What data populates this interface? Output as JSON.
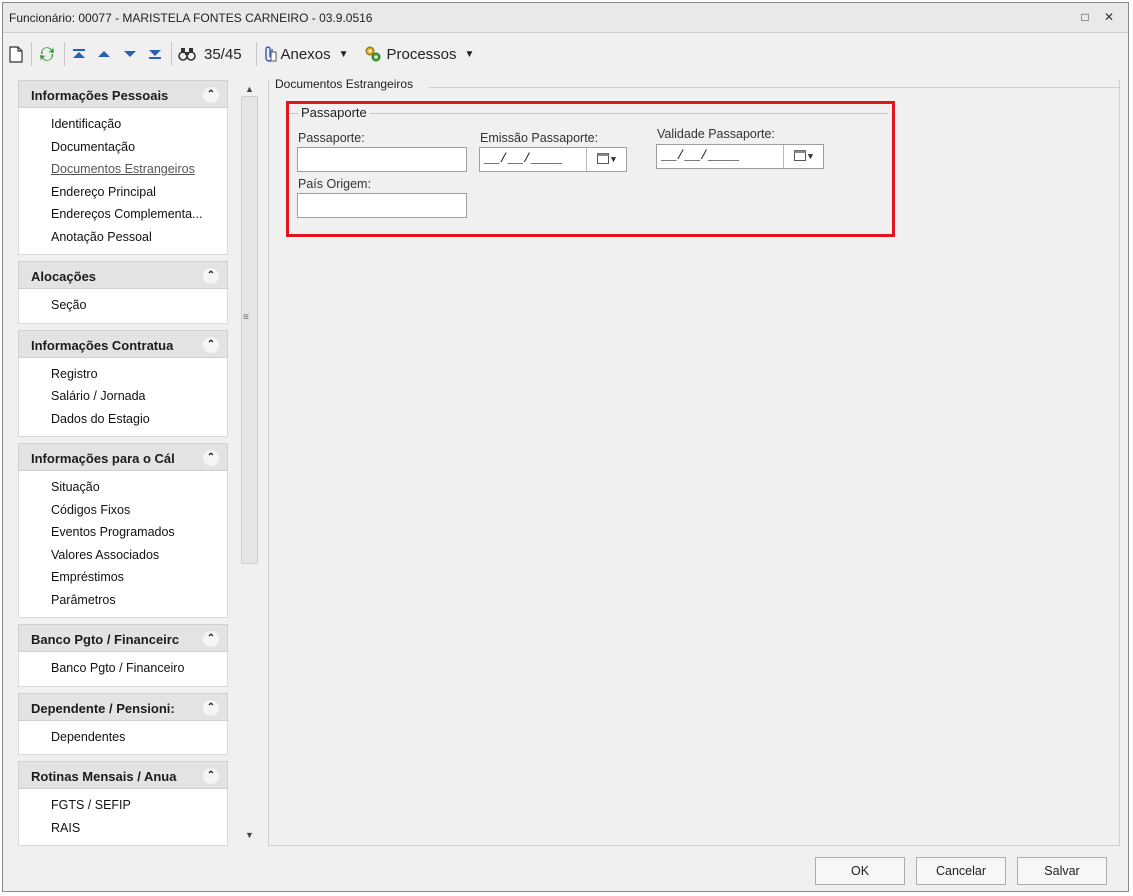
{
  "window": {
    "title": "Funcionário: 00077 - MARISTELA FONTES CARNEIRO - 03.9.0516",
    "controls": "□ ✕"
  },
  "toolbar": {
    "record_counter": "35/45",
    "anexos_label": "Anexos",
    "processos_label": "Processos"
  },
  "nav": {
    "groups": [
      {
        "title": "Informações Pessoais",
        "items": [
          "Identificação",
          "Documentação",
          "Documentos Estrangeiros",
          "Endereço Principal",
          "Endereços Complementa...",
          "Anotação Pessoal"
        ]
      },
      {
        "title": "Alocações",
        "items": [
          "Seção"
        ]
      },
      {
        "title": "Informações Contratua",
        "items": [
          "Registro",
          "Salário / Jornada",
          "Dados do Estagio"
        ]
      },
      {
        "title": "Informações para o Cál",
        "items": [
          "Situação",
          "Códigos Fixos",
          "Eventos Programados",
          "Valores Associados",
          "Empréstimos",
          "Parâmetros"
        ]
      },
      {
        "title": "Banco Pgto / Financeirc",
        "items": [
          "Banco Pgto / Financeiro"
        ]
      },
      {
        "title": "Dependente / Pensioni:",
        "items": [
          "Dependentes"
        ]
      },
      {
        "title": "Rotinas Mensais / Anua",
        "items": [
          "FGTS / SEFIP",
          "RAIS"
        ]
      }
    ],
    "active_item": "Documentos Estrangeiros"
  },
  "main": {
    "section_title": "Documentos Estrangeiros",
    "fieldset_title": "Passaporte",
    "fields": {
      "passaporte_label": "Passaporte:",
      "passaporte_value": "",
      "emissao_label": "Emissão Passaporte:",
      "emissao_value": "__/__/____",
      "validade_label": "Validade Passaporte:",
      "validade_value": "__/__/____",
      "pais_label": "País Origem:",
      "pais_value": ""
    }
  },
  "footer": {
    "ok_label": "OK",
    "cancel_label": "Cancelar",
    "save_label": "Salvar"
  },
  "colors": {
    "highlight": "#e0161c",
    "refresh_icon": "#2e9a2e",
    "nav_arrows": "#2a5fb5"
  }
}
